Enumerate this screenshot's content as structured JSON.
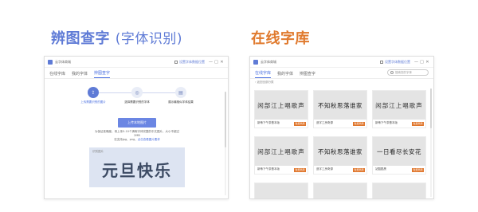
{
  "headings": {
    "left_main": "辨图查字",
    "left_sub": "(字体识别)",
    "right_main": "在线字库"
  },
  "colors": {
    "left_heading": "#5f7bd6",
    "right_heading": "#e07a2e",
    "accent": "#4a6fe0",
    "badge": "#e0762c"
  },
  "left_window": {
    "app_title": "云字体商城",
    "top_link": "设置字体数据位置",
    "controls": [
      "—",
      "□",
      "✕"
    ],
    "tabs": [
      "在线字库",
      "我的字体",
      "辨图查字"
    ],
    "active_tab": "辨图查字",
    "steps": [
      {
        "icon": "upload-icon",
        "label": "上传需要识别的图片",
        "active": true
      },
      {
        "icon": "scan-icon",
        "label": "选择需要识别的字体",
        "active": false
      },
      {
        "icon": "result-icon",
        "label": "展示最相似字体结果",
        "active": false
      }
    ],
    "upload_button": "上传本地图片",
    "hint_line1": "为保证准确度，请上传5-10个清晰字体完整的中文图片，大小不超过2MB",
    "hint_line2": "仅支持jpg、png，",
    "hint_link": "点击查看图片要求",
    "sample_tag": "识别图片",
    "sample_text": "元旦快乐"
  },
  "right_window": {
    "app_title": "云字体商城",
    "top_link": "设置字体数据位置",
    "controls": [
      "—",
      "□",
      "✕"
    ],
    "tabs": [
      "在线字库",
      "我的字体",
      "辨图查字"
    ],
    "active_tab": "在线字库",
    "search_placeholder": "搜索您的字体",
    "breadcrumb": "‹ 返回全部分类",
    "cards": [
      {
        "preview": "闲部江上唱歌声",
        "name": "新蒂下午茶基本版",
        "badge": "免费商用",
        "serif": true
      },
      {
        "preview": "不知秋思落谁家",
        "name": "造字工房奇源",
        "badge": "免费商用",
        "serif": false
      },
      {
        "preview": "闲部江上唱歌声",
        "name": "新蒂下午茶基本版",
        "badge": "免费商用",
        "serif": true
      },
      {
        "preview": "闲部江上唱歌声",
        "name": "新蒂下午茶基本版",
        "badge": "免费商用",
        "serif": true
      },
      {
        "preview": "不知秋思落谁家",
        "name": "造字工房奇源",
        "badge": "免费商用",
        "serif": false
      },
      {
        "preview": "一日看尽长安花",
        "name": "站酷酷黑",
        "badge": "免费商用",
        "serif": false
      },
      {
        "preview": "",
        "name": "",
        "badge": "",
        "serif": false
      },
      {
        "preview": "",
        "name": "",
        "badge": "",
        "serif": false
      },
      {
        "preview": "",
        "name": "",
        "badge": "",
        "serif": false
      }
    ]
  }
}
